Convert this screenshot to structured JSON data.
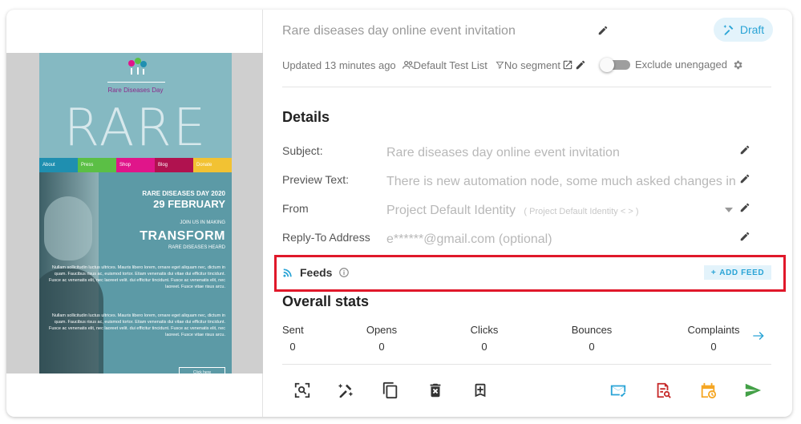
{
  "email_preview": {
    "logo_text": "Rare Diseases Day",
    "hero_word": "RARE",
    "nav": [
      "About",
      "Press",
      "Shop",
      "Blog",
      "Donate"
    ],
    "nav_colors": [
      "#1f8fb0",
      "#5bbf45",
      "#e0158a",
      "#b0124f",
      "#f2c233"
    ],
    "event_line": "RARE DISEASES DAY 2020",
    "date_line": "29 FEBRUARY",
    "join_line": "JOIN US IN MAKING",
    "transform_line": "TRANSFORM",
    "heard_line": "RARE DISEASES HEARD",
    "lorem_1": "Nullam sollicitudin luctus ultrices. Mauris libero lorem, ornare eget aliquam nec, dictum in quam. Faucibus risus ac, euismod tortor. Etiam venenatis dui vitae dui efficitur tincidunt. Fusce ac venenatis elit, nec laoreet velit. dui efficitur tincidunt. Fusce ac venenatis elit, nec laoreet. Fusce vitae risus arcu.",
    "lorem_2": "Nullam sollicitudin luctus ultrices. Mauris libero lorem, ornare eget aliquam nec, dictum in quam. Faucibus risus ac, euismod tortor. Etiam venenatis dui vitae dui efficitur tincidunt. Fusce ac venenatis elit, nec laoreet velit. dui efficitur tincidunt. Fusce ac venenatis elit, nec laoreet. Fusce vitae risus arcu.",
    "button_text": "Click here"
  },
  "campaign": {
    "title": "Rare diseases day online event invitation",
    "status": "Draft",
    "updated": "Updated 13 minutes ago",
    "list": "Default Test List",
    "segment": "No segment",
    "exclude_label": "Exclude unengaged",
    "exclude_on": false
  },
  "details": {
    "heading": "Details",
    "rows": [
      {
        "label": "Subject:",
        "value": "Rare diseases day online event invitation"
      },
      {
        "label": "Preview Text:",
        "value": "There is new automation node, some much asked changes in"
      },
      {
        "label": "From",
        "value": "Project Default Identity",
        "extra": "( Project Default Identity < > )"
      },
      {
        "label": "Reply-To Address",
        "value": "e******@gmail.com (optional)"
      }
    ]
  },
  "feeds": {
    "label": "Feeds",
    "add_label": "ADD FEED"
  },
  "stats": {
    "heading": "Overall stats",
    "items": [
      {
        "label": "Sent",
        "value": "0"
      },
      {
        "label": "Opens",
        "value": "0"
      },
      {
        "label": "Clicks",
        "value": "0"
      },
      {
        "label": "Bounces",
        "value": "0"
      },
      {
        "label": "Complaints",
        "value": "0"
      }
    ]
  },
  "colors": {
    "accent": "#2aa4d6",
    "highlight_border": "#e0182a",
    "send": "#43a047",
    "schedule": "#f5a623",
    "analytics": "#c62828"
  }
}
